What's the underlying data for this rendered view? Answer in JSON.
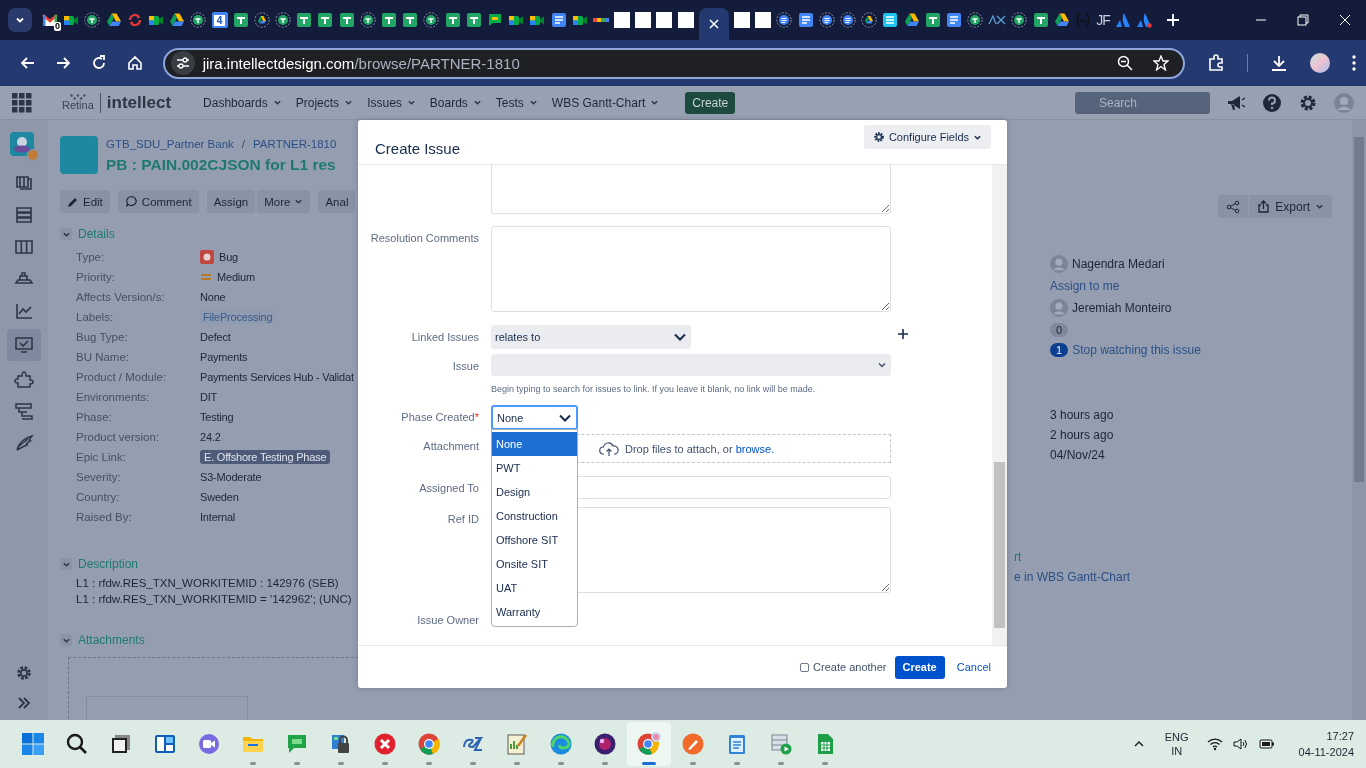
{
  "browser": {
    "tabs": [
      {
        "kind": "mail",
        "badge": "0",
        "selected": false
      },
      {
        "kind": "meet",
        "selected": false
      },
      {
        "kind": "sheets-ring",
        "selected": false
      },
      {
        "kind": "drive",
        "selected": false
      },
      {
        "kind": "sync",
        "selected": false
      },
      {
        "kind": "meet",
        "selected": false
      },
      {
        "kind": "drive",
        "selected": false
      },
      {
        "kind": "sheets-ring",
        "selected": false
      },
      {
        "kind": "calendar",
        "badge": "4",
        "selected": false
      },
      {
        "kind": "sheets",
        "selected": false
      },
      {
        "kind": "drive-ring",
        "selected": false
      },
      {
        "kind": "sheets-ring",
        "selected": false
      },
      {
        "kind": "sheets",
        "selected": false
      },
      {
        "kind": "sheets",
        "selected": false
      },
      {
        "kind": "sheets",
        "selected": false
      },
      {
        "kind": "sheets-ring",
        "selected": false
      },
      {
        "kind": "sheets",
        "selected": false
      },
      {
        "kind": "sheets",
        "selected": false
      },
      {
        "kind": "sheets-ring",
        "selected": false
      },
      {
        "kind": "sheets",
        "selected": false
      },
      {
        "kind": "sheets",
        "selected": false
      },
      {
        "kind": "chat",
        "selected": false
      },
      {
        "kind": "meet",
        "selected": false
      },
      {
        "kind": "meet",
        "selected": false
      },
      {
        "kind": "docs",
        "selected": false
      },
      {
        "kind": "meet",
        "selected": false
      },
      {
        "kind": "dots",
        "selected": false
      },
      {
        "kind": "blank",
        "selected": false
      },
      {
        "kind": "blank",
        "selected": false
      },
      {
        "kind": "blank",
        "selected": false
      },
      {
        "kind": "blank",
        "selected": false
      },
      {
        "selected": true
      },
      {
        "kind": "blank",
        "selected": false
      },
      {
        "kind": "blank",
        "selected": false
      },
      {
        "kind": "docs-ring",
        "selected": false
      },
      {
        "kind": "docs",
        "selected": false
      },
      {
        "kind": "docs-ring",
        "selected": false
      },
      {
        "kind": "docs-ring",
        "selected": false
      },
      {
        "kind": "drive-ring",
        "selected": false
      },
      {
        "kind": "docs-cyan",
        "selected": false
      },
      {
        "kind": "drive",
        "selected": false
      },
      {
        "kind": "sheets",
        "selected": false
      },
      {
        "kind": "docs",
        "selected": false
      },
      {
        "kind": "sheets-ring",
        "selected": false
      },
      {
        "kind": "arx",
        "selected": false
      },
      {
        "kind": "sheets-ring",
        "selected": false
      },
      {
        "kind": "sheets",
        "selected": false
      },
      {
        "kind": "drive",
        "selected": false
      },
      {
        "kind": "brackets",
        "selected": false
      },
      {
        "kind": "text",
        "badge": "JF",
        "selected": false
      },
      {
        "kind": "atlassian",
        "selected": false
      },
      {
        "kind": "atlassian-dot",
        "selected": false
      }
    ],
    "address": {
      "host": "jira.intellectdesign.com",
      "path": "/browse/PARTNER-1810"
    }
  },
  "jira": {
    "logo": {
      "product": "Retina",
      "brand": "intellect"
    },
    "nav": [
      {
        "label": "Dashboards"
      },
      {
        "label": "Projects"
      },
      {
        "label": "Issues"
      },
      {
        "label": "Boards"
      },
      {
        "label": "Tests"
      },
      {
        "label": "WBS Gantt-Chart"
      }
    ],
    "create": "Create",
    "search": {
      "placeholder": "Search"
    }
  },
  "sidebar": {
    "items": [
      {
        "kind": "cards",
        "selected": false
      },
      {
        "kind": "stack",
        "selected": false
      },
      {
        "kind": "columns",
        "selected": false
      },
      {
        "kind": "boat",
        "selected": false
      },
      {
        "kind": "chart",
        "selected": false
      },
      {
        "kind": "monitor",
        "selected": true
      },
      {
        "kind": "puzzle",
        "selected": false
      },
      {
        "kind": "list",
        "selected": false
      },
      {
        "kind": "wing",
        "selected": false
      }
    ]
  },
  "issue": {
    "breadcrumb": {
      "project": "GTB_SDU_Partner Bank",
      "separator": "/",
      "key": "PARTNER-1810"
    },
    "title": "PB : PAIN.002CJSON for L1 res",
    "actions": [
      {
        "kind": "edit",
        "label": "Edit"
      },
      {
        "kind": "comment",
        "label": "Comment"
      },
      {
        "kind": "plain",
        "label": "Assign"
      },
      {
        "kind": "menu",
        "label": "More"
      },
      {
        "kind": "plain",
        "label": "Anal"
      }
    ],
    "details": {
      "heading": "Details",
      "fields": [
        {
          "label": "Type:",
          "value": "Bug",
          "kind": "type"
        },
        {
          "label": "Priority:",
          "value": "Medium",
          "kind": "priority"
        },
        {
          "label": "Affects Version/s:",
          "value": "None",
          "kind": "text"
        },
        {
          "label": "Labels:",
          "value": "FileProcessing",
          "kind": "label"
        },
        {
          "label": "Bug Type:",
          "value": "Defect",
          "kind": "text"
        },
        {
          "label": "BU Name:",
          "value": "Payments",
          "kind": "text"
        },
        {
          "label": "Product / Module:",
          "value": "Payments Services Hub - Validat",
          "kind": "text"
        },
        {
          "label": "Environments:",
          "value": "DIT",
          "kind": "text"
        },
        {
          "label": "Phase:",
          "value": "Testing",
          "kind": "text"
        },
        {
          "label": "Product version:",
          "value": "24.2",
          "kind": "text"
        },
        {
          "label": "Epic Link:",
          "value": "E. Offshore Testing Phase",
          "kind": "epic"
        },
        {
          "label": "Severity:",
          "value": "S3-Moderate",
          "kind": "text"
        },
        {
          "label": "Country:",
          "value": "Sweden",
          "kind": "text"
        },
        {
          "label": "Raised By:",
          "value": "Internal",
          "kind": "text"
        }
      ]
    },
    "description": {
      "heading": "Description",
      "lines": [
        "L1 : rfdw.RES_TXN_WORKITEMID : 142976 (SEB)",
        "L1 : rfdw.RES_TXN_WORKITEMID = '142962'; (UNC)"
      ]
    },
    "attachments": {
      "heading": "Attachments"
    }
  },
  "right": {
    "export": "Export",
    "people": {
      "assignee": "Nagendra Medari",
      "assign_link": "Assign to me",
      "reporter": "Jeremiah Monteiro",
      "votes": "0",
      "watchers": "1",
      "watch_link": "Stop watching this issue"
    },
    "dates": [
      "3 hours ago",
      "2 hours ago",
      "04/Nov/24"
    ],
    "fragments": [
      {
        "kind": "heading",
        "text": "rt"
      },
      {
        "kind": "link",
        "text": "e in WBS Gantt-Chart"
      }
    ]
  },
  "modal": {
    "title": "Create Issue",
    "configure": "Configure Fields",
    "fields": [
      {
        "kind": "textarea-top"
      },
      {
        "kind": "textarea",
        "label": "Resolution Comments"
      },
      {
        "kind": "linked",
        "label": "Linked Issues",
        "value": "relates to"
      },
      {
        "kind": "select",
        "label": "Issue"
      },
      {
        "kind": "hint",
        "text": "Begin typing to search for issues to link. If you leave it blank, no link will be made."
      },
      {
        "kind": "phase",
        "label": "Phase Created",
        "required_mark": "*",
        "value": "None",
        "expanded": true,
        "options": [
          {
            "label": "None",
            "selected": true
          },
          {
            "label": "PWT",
            "selected": false
          },
          {
            "label": "Design",
            "selected": false
          },
          {
            "label": "Construction",
            "selected": false
          },
          {
            "label": "Offshore SIT",
            "selected": false
          },
          {
            "label": "Onsite SIT",
            "selected": false
          },
          {
            "label": "UAT",
            "selected": false
          },
          {
            "label": "Warranty",
            "selected": false
          }
        ]
      },
      {
        "kind": "attachment",
        "label": "Attachment",
        "text": "Drop files to attach, or ",
        "link": "browse."
      },
      {
        "kind": "input",
        "label": "Assigned To"
      },
      {
        "kind": "textarea-ref",
        "label": "Ref ID"
      },
      {
        "kind": "owner",
        "label": "Issue Owner"
      }
    ],
    "footer": {
      "create_another": {
        "label": "Create another",
        "checked": false
      },
      "submit": "Create",
      "cancel": "Cancel"
    }
  },
  "taskbar": {
    "apps": [
      {
        "kind": "start",
        "running": false
      },
      {
        "kind": "search",
        "running": false
      },
      {
        "kind": "taskview",
        "running": false
      },
      {
        "kind": "widgets",
        "running": false
      },
      {
        "kind": "teams",
        "running": false
      },
      {
        "kind": "explorer",
        "running": true
      },
      {
        "kind": "chat",
        "running": true
      },
      {
        "kind": "lock",
        "running": true
      },
      {
        "kind": "xapp",
        "running": true
      },
      {
        "kind": "chrome",
        "running": true
      },
      {
        "kind": "ez",
        "running": true
      },
      {
        "kind": "editor",
        "running": true
      },
      {
        "kind": "edge",
        "running": true
      },
      {
        "kind": "orb",
        "running": true
      },
      {
        "kind": "chrome-profile",
        "running": true,
        "selected": true
      },
      {
        "kind": "pen",
        "running": true
      },
      {
        "kind": "notepad",
        "running": true
      },
      {
        "kind": "media",
        "running": true
      },
      {
        "kind": "calc",
        "running": true
      }
    ],
    "language": {
      "code": "ENG",
      "region": "IN"
    },
    "time": "17:27",
    "date": "04-11-2024"
  }
}
